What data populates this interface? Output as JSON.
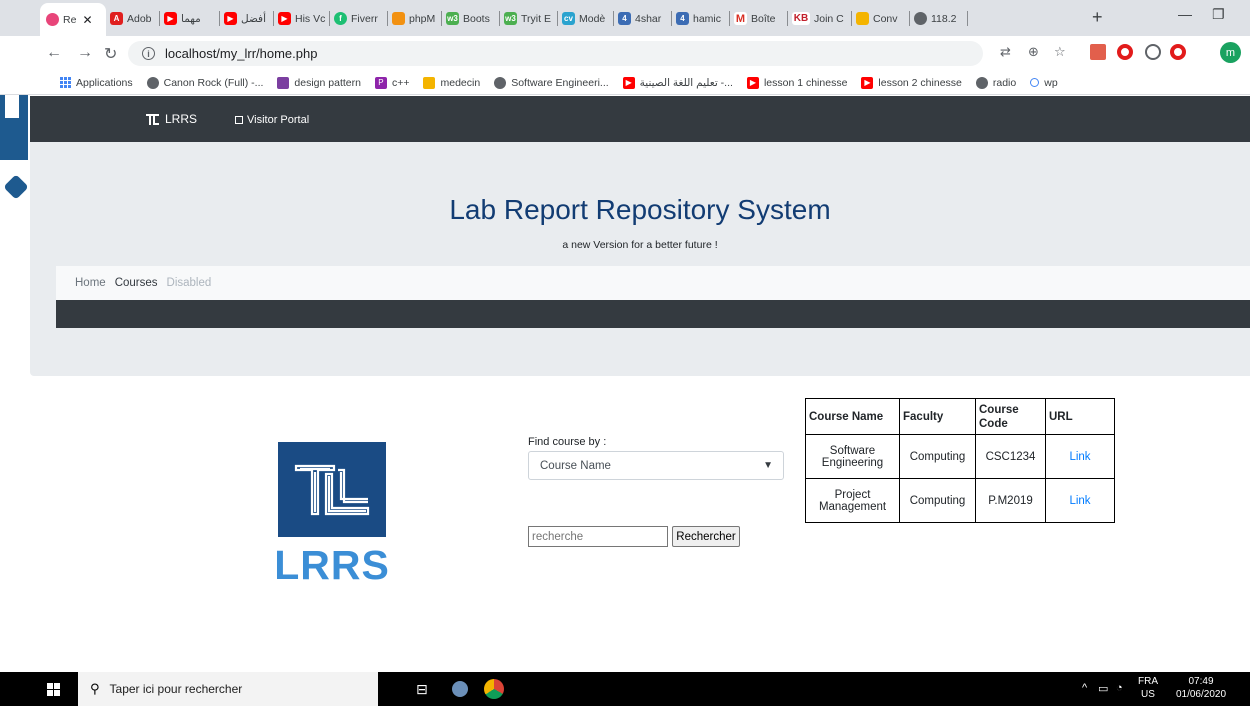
{
  "browser": {
    "tabs": [
      {
        "label": "Re",
        "icon": "site-icon",
        "color": "#e8457a"
      },
      {
        "label": "Adob",
        "icon": "adobe-icon",
        "color": "#e01f1f"
      },
      {
        "label": "مهما",
        "icon": "youtube-icon",
        "color": "#ff0000"
      },
      {
        "label": "أفضل",
        "icon": "youtube-icon",
        "color": "#ff0000"
      },
      {
        "label": "His Vc",
        "icon": "youtube-icon",
        "color": "#ff0000"
      },
      {
        "label": "Fiverr",
        "icon": "fiverr-icon",
        "color": "#1dbf73"
      },
      {
        "label": "phpM",
        "icon": "phpmyadmin-icon",
        "color": "#f29111"
      },
      {
        "label": "Boots",
        "icon": "w3schools-icon",
        "color": "#4caf50"
      },
      {
        "label": "Tryit E",
        "icon": "w3schools-icon",
        "color": "#4caf50"
      },
      {
        "label": "Modè",
        "icon": "cv-icon",
        "color": "#2aa3cf"
      },
      {
        "label": "4shar",
        "icon": "4shared-icon",
        "color": "#3c6cb4"
      },
      {
        "label": "hamic",
        "icon": "4shared-icon",
        "color": "#3c6cb4"
      },
      {
        "label": "Boîte",
        "icon": "gmail-icon",
        "color": "#d93025"
      },
      {
        "label": "Join C",
        "icon": "kb-icon",
        "color": "#c21f2b"
      },
      {
        "label": "Conv",
        "icon": "convert-icon",
        "color": "#f4b400"
      },
      {
        "label": "118.2",
        "icon": "globe-icon",
        "color": "#5f6368"
      }
    ],
    "url": "localhost/my_lrr/home.php",
    "avatar_letter": "m",
    "bookmarks": [
      {
        "label": "Applications",
        "icon": "apps-icon",
        "color": "#4285f4"
      },
      {
        "label": "Canon Rock (Full) -...",
        "icon": "globe-icon",
        "color": "#5f6368"
      },
      {
        "label": "design pattern",
        "icon": "bird-icon",
        "color": "#7b3fa0"
      },
      {
        "label": "c++",
        "icon": "p-icon",
        "color": "#8e24aa"
      },
      {
        "label": "medecin",
        "icon": "book-icon",
        "color": "#f4b400"
      },
      {
        "label": "Software Engineeri...",
        "icon": "globe-icon",
        "color": "#5f6368"
      },
      {
        "label": "تعليم اللغة الصينية -...",
        "icon": "youtube-icon",
        "color": "#ff0000"
      },
      {
        "label": "lesson 1 chinesse",
        "icon": "youtube-icon",
        "color": "#ff0000"
      },
      {
        "label": "lesson 2 chinesse",
        "icon": "youtube-icon",
        "color": "#ff0000"
      },
      {
        "label": "radio",
        "icon": "globe-icon",
        "color": "#5f6368"
      },
      {
        "label": "wp",
        "icon": "wp-icon",
        "color": "#4285f4"
      }
    ]
  },
  "site": {
    "brand": "LRRS",
    "visitor_portal": "Visitor Portal",
    "title": "Lab Report Repository System",
    "subtitle": "a new Version for a better future !",
    "breadcrumb": {
      "home": "Home",
      "courses": "Courses",
      "disabled": "Disabled"
    },
    "logo_text": "LRRS",
    "find_label": "Find course by :",
    "select_value": "Course Name",
    "search_placeholder": "recherche",
    "search_button": "Rechercher",
    "table": {
      "headers": [
        "Course Name",
        "Faculty",
        "Course Code",
        "URL"
      ],
      "rows": [
        [
          "Software Engineering",
          "Computing",
          "CSC1234",
          "Link"
        ],
        [
          "Project Management",
          "Computing",
          "P.M2019",
          "Link"
        ]
      ]
    },
    "colors": {
      "navbar": "#343a40",
      "title": "#123c73",
      "logo": "#1a4b84",
      "link": "#007bff"
    }
  },
  "taskbar": {
    "search_placeholder": "Taper ici pour rechercher",
    "lang_top": "FRA",
    "lang_bottom": "US",
    "time": "07:49",
    "date": "01/06/2020"
  }
}
